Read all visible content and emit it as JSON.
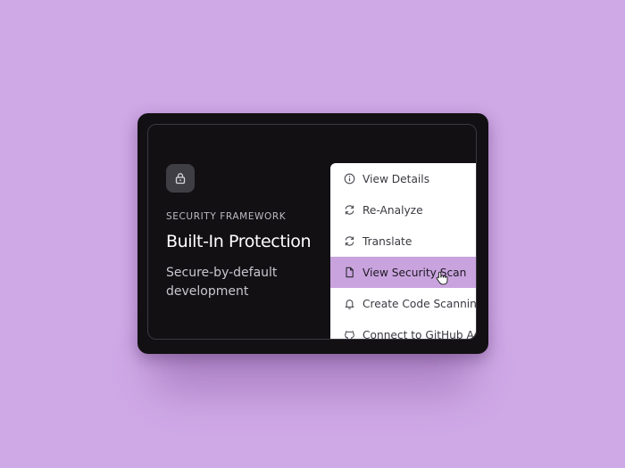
{
  "card": {
    "eyebrow": "SECURITY FRAMEWORK",
    "title": "Built-In Protection",
    "subtitle": "Secure-by-default development",
    "icon": "lock-icon"
  },
  "menu": {
    "items": [
      {
        "label": "View Details",
        "icon": "info-icon"
      },
      {
        "label": "Re-Analyze",
        "icon": "refresh-icon"
      },
      {
        "label": "Translate",
        "icon": "refresh-icon"
      },
      {
        "label": "View Security Scan",
        "icon": "document-icon",
        "active": true
      },
      {
        "label": "Create Code Scanning",
        "icon": "bell-icon"
      },
      {
        "label": "Connect to GitHub Ac",
        "icon": "github-icon"
      }
    ]
  },
  "colors": {
    "background": "#cfa8e6",
    "card": "#121013",
    "active_item": "#c9a3de"
  }
}
